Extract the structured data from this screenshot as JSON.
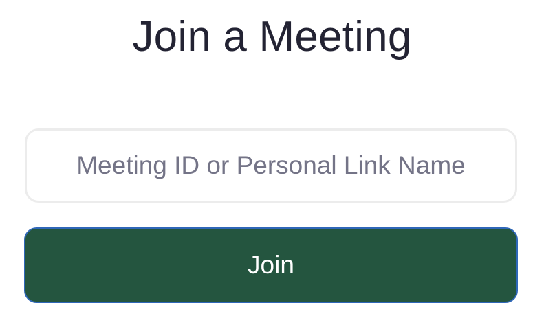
{
  "title": "Join a Meeting",
  "meeting_field": {
    "value": "",
    "placeholder": "Meeting ID or Personal Link Name"
  },
  "join_button": {
    "label": "Join"
  },
  "colors": {
    "title_text": "#232333",
    "placeholder_text": "#747487",
    "field_border": "#ececec",
    "button_bg": "#24553f",
    "button_border": "#2f67b8",
    "button_text": "#ffffff"
  }
}
